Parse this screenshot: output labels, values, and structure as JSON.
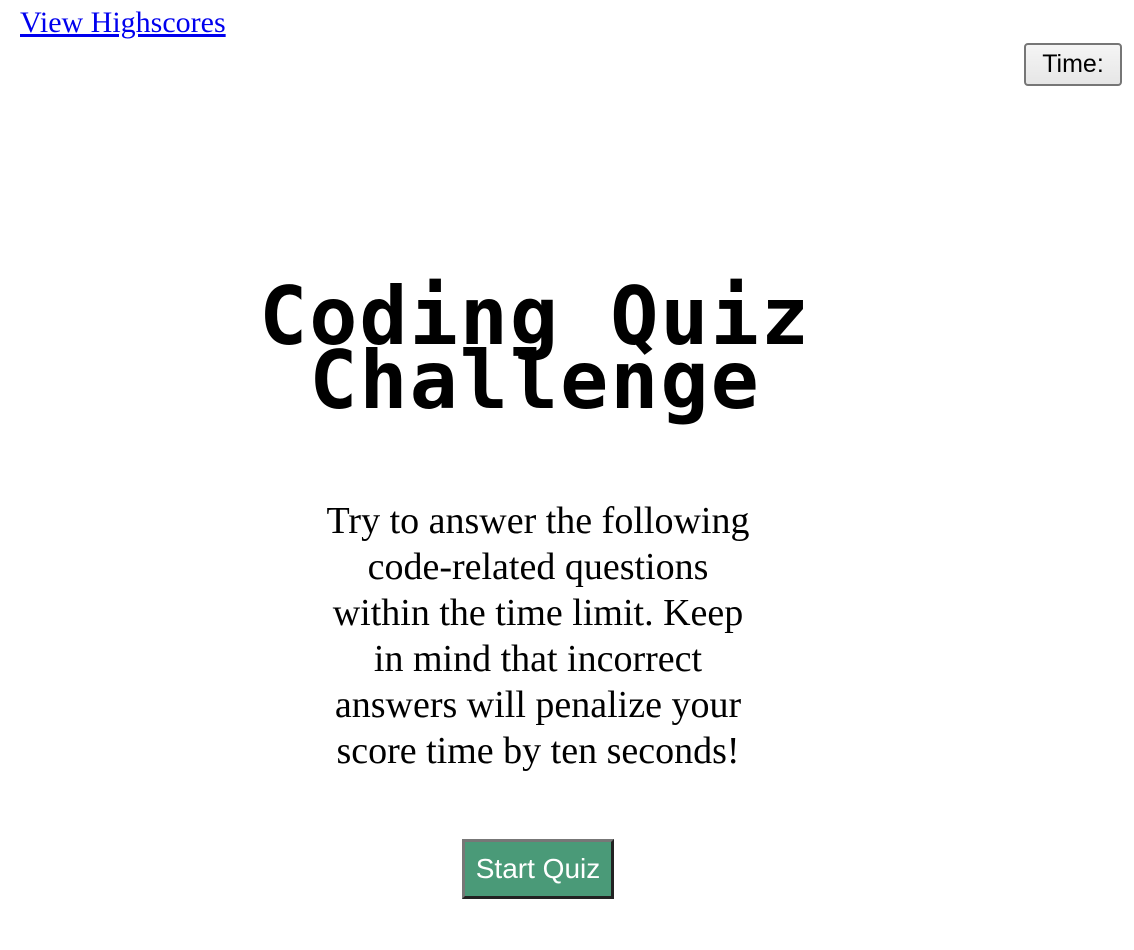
{
  "header": {
    "highscores_link": "View Highscores",
    "time_label": "Time:"
  },
  "main": {
    "title_line1": "Coding Quiz",
    "title_line2": "Challenge",
    "intro_text": "Try to answer the following code-related questions within the time limit. Keep in mind that incorrect answers will penalize your score time by ten seconds!",
    "start_button_label": "Start Quiz"
  },
  "colors": {
    "link": "#0000ee",
    "start_button_bg": "#4a9a78",
    "start_button_text": "#ffffff"
  }
}
